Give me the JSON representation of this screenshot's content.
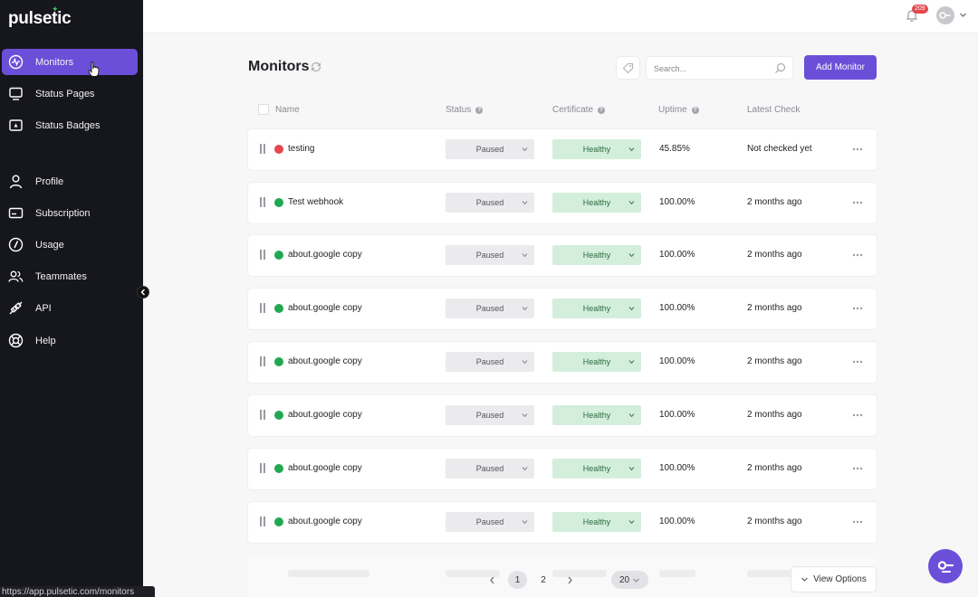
{
  "app": {
    "logo": "pulsetic"
  },
  "sidebar": {
    "items": [
      {
        "label": "Monitors",
        "icon": "monitor-pulse-icon"
      },
      {
        "label": "Status Pages",
        "icon": "display-icon"
      },
      {
        "label": "Status Badges",
        "icon": "badge-icon"
      },
      {
        "label": "Profile",
        "icon": "user-icon"
      },
      {
        "label": "Subscription",
        "icon": "card-icon"
      },
      {
        "label": "Usage",
        "icon": "gauge-icon"
      },
      {
        "label": "Teammates",
        "icon": "users-icon"
      },
      {
        "label": "API",
        "icon": "plug-icon"
      },
      {
        "label": "Help",
        "icon": "lifebuoy-icon"
      }
    ],
    "active": "Monitors"
  },
  "topbar": {
    "notifications_count": "209"
  },
  "header": {
    "title": "Monitors",
    "search_placeholder": "Search...",
    "add_button": "Add Monitor"
  },
  "table": {
    "columns": {
      "name": "Name",
      "status": "Status",
      "certificate": "Certificate",
      "uptime": "Uptime",
      "latest_check": "Latest Check"
    },
    "rows": [
      {
        "name": "testing",
        "status": "Paused",
        "certificate": "Healthy",
        "uptime": "45.85%",
        "latest_check": "Not checked yet",
        "health": "down"
      },
      {
        "name": "Test webhook",
        "status": "Paused",
        "certificate": "Healthy",
        "uptime": "100.00%",
        "latest_check": "2 months ago",
        "health": "up"
      },
      {
        "name": "about.google copy",
        "status": "Paused",
        "certificate": "Healthy",
        "uptime": "100.00%",
        "latest_check": "2 months ago",
        "health": "up"
      },
      {
        "name": "about.google copy",
        "status": "Paused",
        "certificate": "Healthy",
        "uptime": "100.00%",
        "latest_check": "2 months ago",
        "health": "up"
      },
      {
        "name": "about.google copy",
        "status": "Paused",
        "certificate": "Healthy",
        "uptime": "100.00%",
        "latest_check": "2 months ago",
        "health": "up"
      },
      {
        "name": "about.google copy",
        "status": "Paused",
        "certificate": "Healthy",
        "uptime": "100.00%",
        "latest_check": "2 months ago",
        "health": "up"
      },
      {
        "name": "about.google copy",
        "status": "Paused",
        "certificate": "Healthy",
        "uptime": "100.00%",
        "latest_check": "2 months ago",
        "health": "up"
      },
      {
        "name": "about.google copy",
        "status": "Paused",
        "certificate": "Healthy",
        "uptime": "100.00%",
        "latest_check": "2 months ago",
        "health": "up"
      }
    ]
  },
  "pagination": {
    "pages": [
      "1",
      "2"
    ],
    "current": "1",
    "page_size": "20",
    "view_options": "View Options"
  },
  "browser_status": {
    "url": "https://app.pulsetic.com/monitors"
  },
  "colors": {
    "accent": "#6b4fd8",
    "up": "#22a853",
    "down": "#e5484d",
    "healthy_bg": "#d3efdc"
  }
}
